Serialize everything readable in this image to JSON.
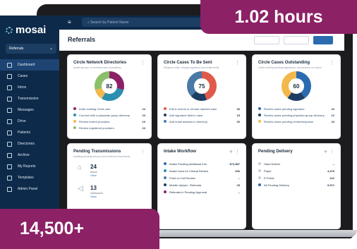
{
  "overlay": {
    "top_stat": "1.02 hours",
    "bottom_stat": "14,500+"
  },
  "app": {
    "logo": "mosai",
    "referrals_select": "Referrals",
    "search_placeholder": "Search by Patient Name",
    "page_title": "Referrals"
  },
  "nav": [
    {
      "label": "Dashboard",
      "icon": "grid-icon"
    },
    {
      "label": "Cases",
      "icon": "cases-icon"
    },
    {
      "label": "Inbox",
      "icon": "inbox-icon"
    },
    {
      "label": "Transmission",
      "icon": "send-icon"
    },
    {
      "label": "Messages",
      "icon": "chat-icon"
    },
    {
      "label": "Drive",
      "icon": "drive-icon"
    },
    {
      "label": "Patients",
      "icon": "people-icon"
    },
    {
      "label": "Directories",
      "icon": "book-icon"
    },
    {
      "label": "Archive",
      "icon": "archive-icon"
    },
    {
      "label": "My Reports",
      "icon": "report-icon"
    },
    {
      "label": "Templates",
      "icon": "template-icon"
    },
    {
      "label": "Admin Panel",
      "icon": "gear-icon"
    }
  ],
  "cards": {
    "network": {
      "title": "Circle Network Directories",
      "subtitle": "Invited groups of members and connections",
      "total": "82",
      "rows": [
        {
          "label": "Invite existing Circle user",
          "count": "24",
          "color": "#8c2166"
        },
        {
          "label": "Connect with a physician group directory",
          "count": "24",
          "color": "#2b8fb0"
        },
        {
          "label": "Review invited providers",
          "count": "10",
          "color": "#f2b84b"
        },
        {
          "label": "Review registered providers",
          "count": "24",
          "color": "#8bbf6a"
        }
      ],
      "chart_data": {
        "type": "pie",
        "categories": [
          "Invite existing Circle user",
          "Connect with a physician group directory",
          "Review invited providers",
          "Review registered providers"
        ],
        "values": [
          24,
          24,
          10,
          24
        ]
      }
    },
    "tobesent": {
      "title": "Circle Cases To Be Sent",
      "subtitle": "Requires edits, missing signature and invalid fields",
      "total": "75",
      "rows": [
        {
          "label": "Edit & resend or reroute rejected case",
          "count": "36",
          "color": "#e05a4b"
        },
        {
          "label": "Add signature field to case",
          "count": "15",
          "color": "#1d3e63"
        },
        {
          "label": "Add email address to directory",
          "count": "30",
          "color": "#4a79a8"
        }
      ],
      "chart_data": {
        "type": "pie",
        "categories": [
          "Edit & resend or reroute rejected case",
          "Add signature field to case",
          "Add email address to directory"
        ],
        "values": [
          36,
          15,
          30
        ]
      }
    },
    "outstanding": {
      "title": "Circle Cases Outstanding",
      "subtitle": "Cases held by pending signatures, connections, or review",
      "total": "60",
      "rows": [
        {
          "label": "Review cases pending signature",
          "count": "24",
          "color": "#2b6cb0"
        },
        {
          "label": "Review cases pending physician group directory...",
          "count": "12",
          "color": "#1d3e63"
        },
        {
          "label": "Review cases pending review/response",
          "count": "24",
          "color": "#f2b84b"
        }
      ],
      "chart_data": {
        "type": "pie",
        "categories": [
          "Review cases pending signature",
          "Review cases pending physician group directory",
          "Review cases pending review/response"
        ],
        "values": [
          24,
          12,
          24
        ]
      }
    },
    "pending": {
      "title": "Pending Transmissions",
      "subtitle": "Awaiting pending inbound and outbound documents",
      "items": [
        {
          "num": "24",
          "label": "Inbox",
          "view": "View"
        },
        {
          "num": "13",
          "label": "Outbound",
          "view": "View"
        }
      ]
    },
    "intake": {
      "title": "Intake Workflow",
      "rows": [
        {
          "label": "Intake Pending Additional Info",
          "count": "$72,887",
          "color": "#2b6cb0"
        },
        {
          "label": "Intake Docs for Clinical Review",
          "count": "636",
          "color": "#2b8fb0"
        },
        {
          "label": "Point on Call Review",
          "count": "--",
          "color": "#4a79a8"
        },
        {
          "label": "Mobile Upload - Referrals",
          "count": "25",
          "color": "#1d3e63"
        },
        {
          "label": "Referrals in Pending Approval",
          "count": "--",
          "color": "#8c2166"
        }
      ]
    },
    "delivery": {
      "title": "Pending Delivery",
      "rows": [
        {
          "label": "Hand Deliver",
          "count": "--",
          "color": "#c7ccd3"
        },
        {
          "label": "Paper",
          "count": "4,378",
          "color": "#c7ccd3"
        },
        {
          "label": "E-Portal",
          "count": "222",
          "color": "#c7ccd3"
        },
        {
          "label": "All Pending Delivery",
          "count": "9,571",
          "color": "#2b6cb0"
        }
      ]
    }
  }
}
